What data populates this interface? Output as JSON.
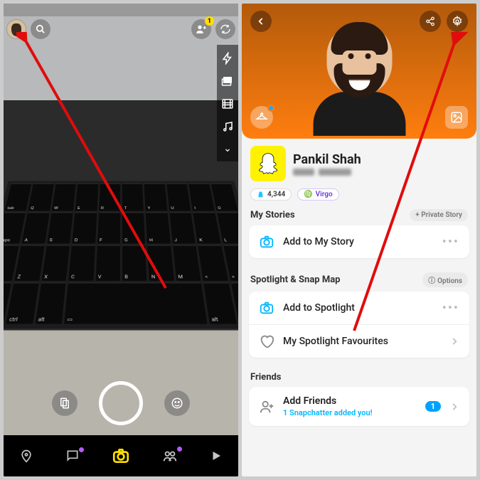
{
  "left": {
    "add_friend_badge": "1",
    "right_tools": [
      "flash",
      "layers",
      "film",
      "music"
    ],
    "nav": [
      "map",
      "chat",
      "camera",
      "people",
      "play"
    ]
  },
  "right": {
    "user_name": "Pankil Shah",
    "score": "4,344",
    "zodiac": "Virgo",
    "sections": {
      "stories": {
        "title": "My Stories",
        "chip": "+ Private Story",
        "item": "Add to My Story"
      },
      "spotlight": {
        "title": "Spotlight & Snap Map",
        "chip": "Options",
        "item1": "Add to Spotlight",
        "item2": "My Spotlight Favourites"
      },
      "friends": {
        "title": "Friends",
        "item": "Add Friends",
        "sub": "1 Snapchatter added you!",
        "count": "1"
      }
    }
  }
}
